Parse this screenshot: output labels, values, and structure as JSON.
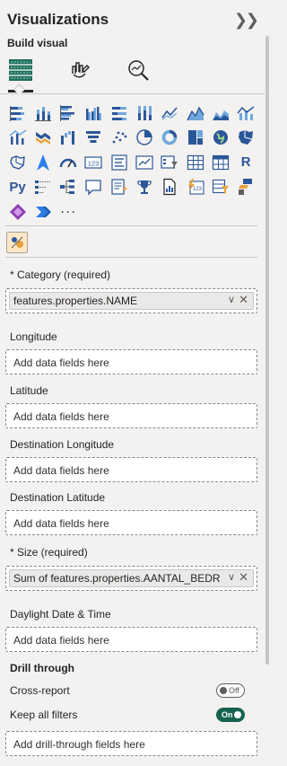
{
  "header": {
    "title": "Visualizations",
    "collapse_icon": "double-chevron-right-icon"
  },
  "build_visual_label": "Build visual",
  "modes": [
    {
      "name": "build-visual-mode",
      "icon": "table-grid-icon",
      "active": true
    },
    {
      "name": "format-visual-mode",
      "icon": "paintbrush-icon",
      "active": false
    },
    {
      "name": "analytics-mode",
      "icon": "magnifier-chart-icon",
      "active": false
    }
  ],
  "visual_types": {
    "glyph_r": "R",
    "glyph_py": "Py",
    "glyph_123": "123",
    "glyph_more": "···"
  },
  "wells": {
    "category": {
      "label": "* Category (required)",
      "value": "features.properties.NAME"
    },
    "longitude": {
      "label": "Longitude",
      "placeholder": "Add data fields here"
    },
    "latitude": {
      "label": "Latitude",
      "placeholder": "Add data fields here"
    },
    "dest_longitude": {
      "label": "Destination Longitude",
      "placeholder": "Add data fields here"
    },
    "dest_latitude": {
      "label": "Destination Latitude",
      "placeholder": "Add data fields here"
    },
    "size": {
      "label": "* Size (required)",
      "value": "Sum of features.properties.AANTAL_BEDRIJF..."
    },
    "daylight": {
      "label": "Daylight Date & Time",
      "placeholder": "Add data fields here"
    }
  },
  "drill": {
    "title": "Drill through",
    "cross_report": {
      "label": "Cross-report",
      "state": "Off"
    },
    "keep_filters": {
      "label": "Keep all filters",
      "state": "On"
    },
    "placeholder": "Add drill-through fields here"
  },
  "colors": {
    "accent": "#2b579a",
    "toggle_on": "#17634f",
    "panel_bg": "#f3f2f1"
  }
}
